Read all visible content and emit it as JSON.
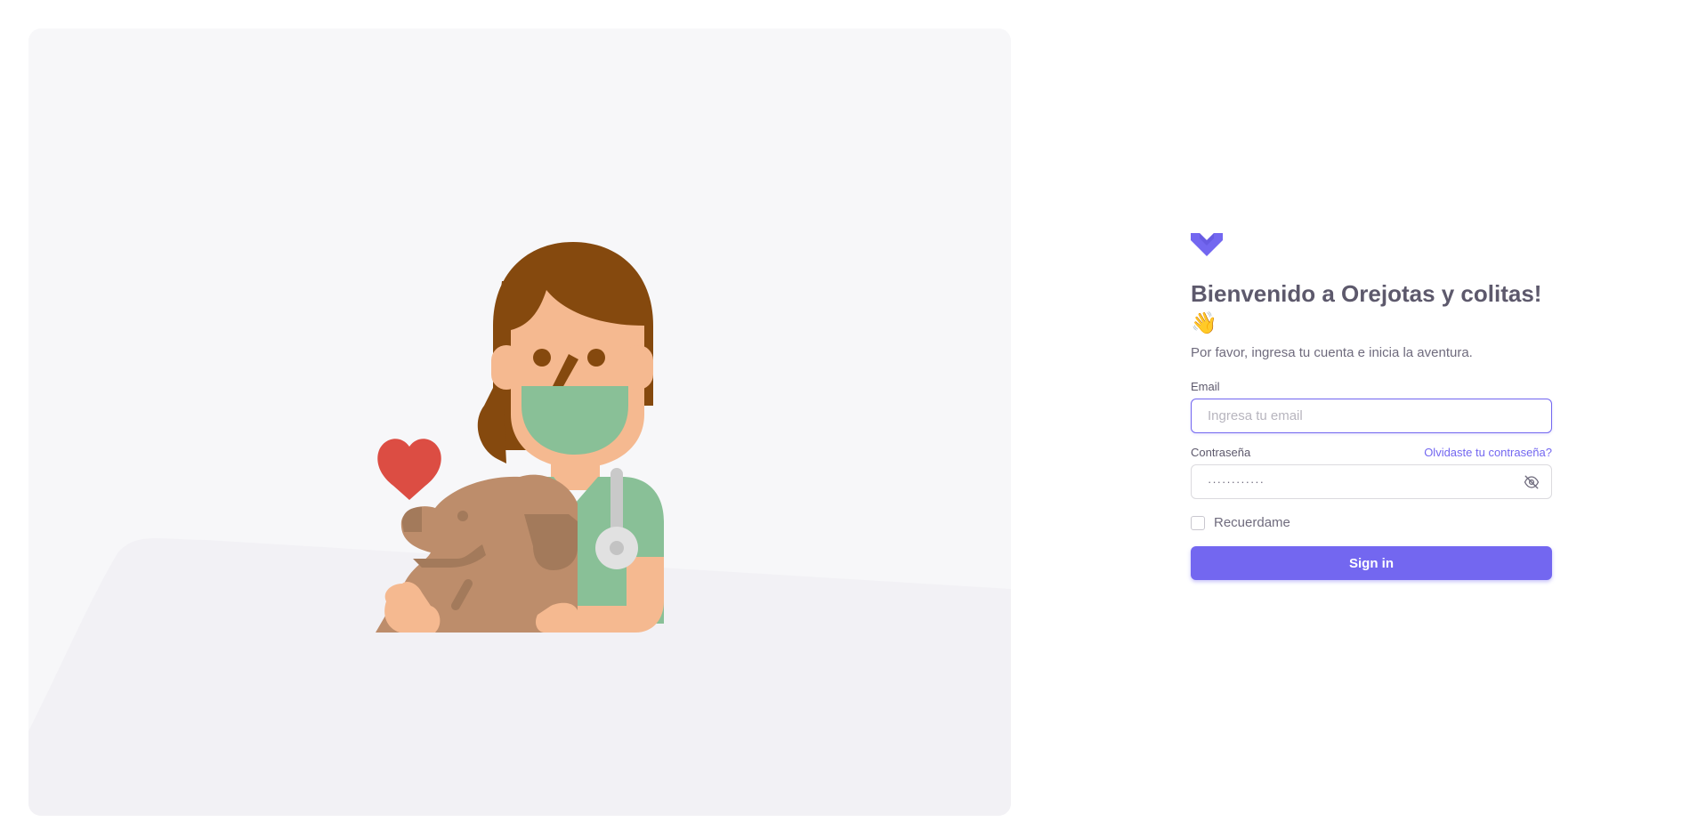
{
  "auth": {
    "title": "Bienvenido a Orejotas y colitas!",
    "wave_emoji": "👋",
    "subtitle": "Por favor, ingresa tu cuenta e inicia la aventura.",
    "email": {
      "label": "Email",
      "placeholder": "Ingresa tu email",
      "value": ""
    },
    "password": {
      "label": "Contraseña",
      "forgot_link": "Olvidaste tu contraseña?",
      "masked_value": "············"
    },
    "remember_label": "Recuerdame",
    "remember_checked": false,
    "signin_label": "Sign in"
  },
  "colors": {
    "primary": "#7367f0",
    "heading": "#5d596c",
    "body": "#6f6b7d",
    "panel_bg": "#f7f7f9"
  },
  "icons": {
    "logo": "brand-logo-icon",
    "password_toggle": "eye-off-icon"
  }
}
